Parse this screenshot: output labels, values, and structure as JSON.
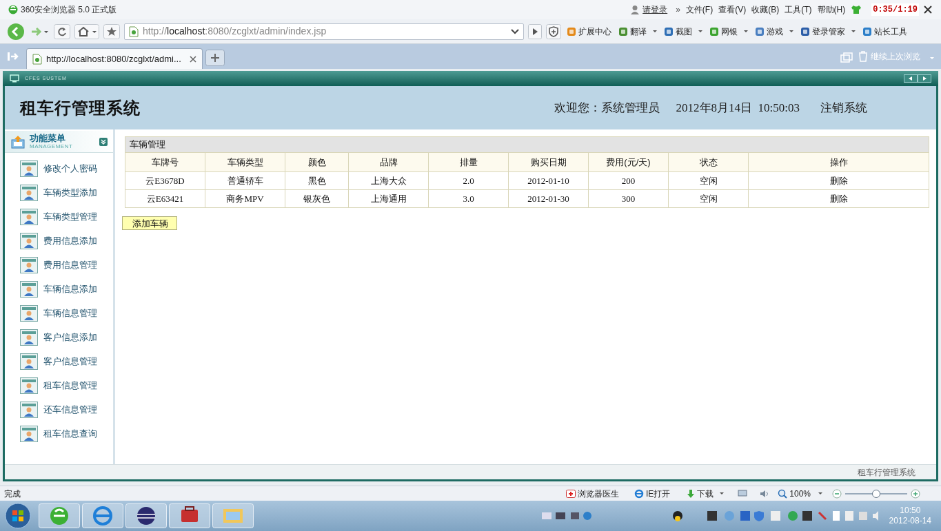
{
  "browser": {
    "title": "360安全浏览器 5.0 正式版",
    "login": "请登录",
    "more": "»",
    "menus": [
      "文件(F)",
      "查看(V)",
      "收藏(B)",
      "工具(T)",
      "帮助(H)"
    ],
    "recording_timer": "0:35/1:19"
  },
  "address_bar": {
    "url_prefix": "http://",
    "url_host": "localhost",
    "url_rest": ":8080/zcglxt/admin/index.jsp"
  },
  "toolbar": [
    {
      "label": "扩展中心",
      "dropdown": false
    },
    {
      "label": "翻译",
      "dropdown": true
    },
    {
      "label": "截图",
      "dropdown": true
    },
    {
      "label": "网银",
      "dropdown": true
    },
    {
      "label": "游戏",
      "dropdown": true
    },
    {
      "label": "登录管家",
      "dropdown": true
    },
    {
      "label": "站长工具",
      "dropdown": false
    }
  ],
  "tabs": [
    {
      "label": "http://localhost:8080/zcglxt/admi...",
      "selected": true
    }
  ],
  "restore_label": "继续上次浏览",
  "frame_label": "CFES SUSTEM",
  "header": {
    "title": "租车行管理系统",
    "welcome": "欢迎您：系统管理员",
    "datetime": "2012年8月14日  10:50:03",
    "logout": "注销系统"
  },
  "sidebar": {
    "title": "功能菜单",
    "subtitle": "MANAGEMENT",
    "items": [
      "修改个人密码",
      "车辆类型添加",
      "车辆类型管理",
      "费用信息添加",
      "费用信息管理",
      "车辆信息添加",
      "车辆信息管理",
      "客户信息添加",
      "客户信息管理",
      "租车信息管理",
      "还车信息管理",
      "租车信息查询"
    ]
  },
  "table": {
    "title": "车辆管理",
    "columns": [
      "车牌号",
      "车辆类型",
      "颜色",
      "品牌",
      "排量",
      "购买日期",
      "费用(元/天)",
      "状态",
      "操作"
    ],
    "rows": [
      [
        "云E3678D",
        "普通轿车",
        "黑色",
        "上海大众",
        "2.0",
        "2012-01-10",
        "200",
        "空闲",
        "删除"
      ],
      [
        "云E63421",
        "商务MPV",
        "银灰色",
        "上海通用",
        "3.0",
        "2012-01-30",
        "300",
        "空闲",
        "删除"
      ]
    ]
  },
  "add_button": "添加车辆",
  "footer": "租车行管理系统",
  "status_bar": {
    "status": "完成",
    "doctor": "浏览器医生",
    "ie_open": "IE打开",
    "download": "下载",
    "zoom": "100%",
    "zoom_slider": {
      "level": 0.5
    }
  },
  "taskbar": {
    "time": "10:50",
    "date": "2012-08-14"
  }
}
